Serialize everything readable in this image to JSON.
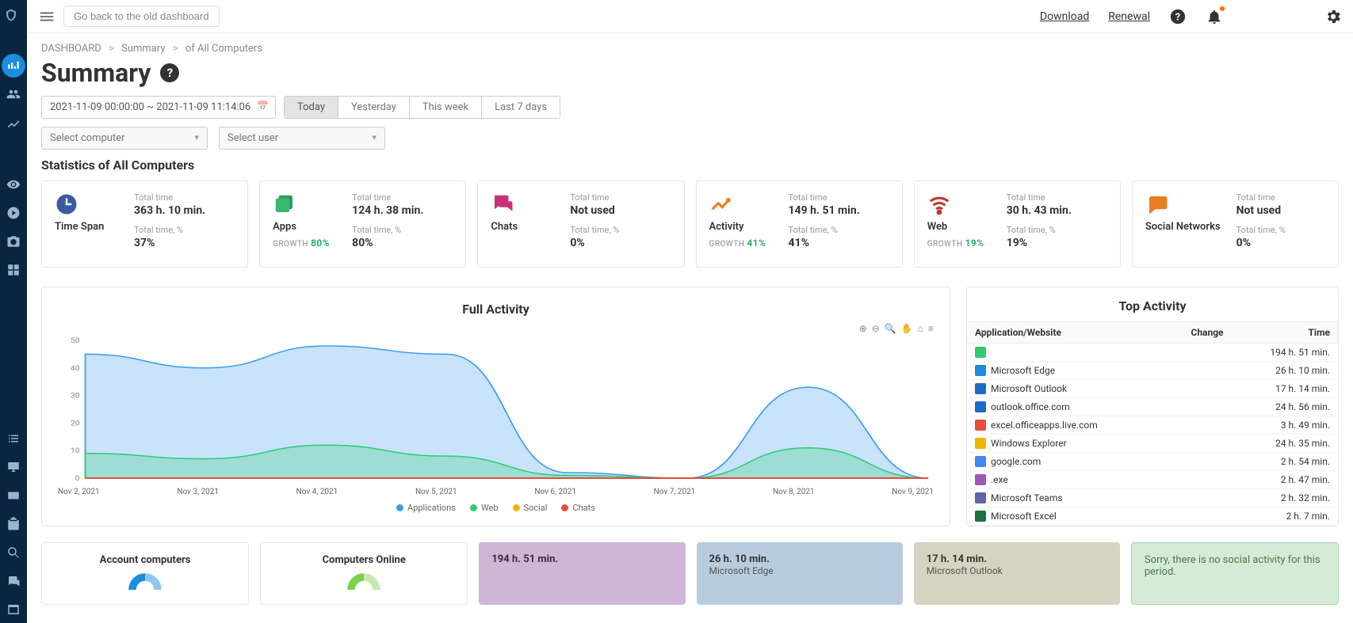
{
  "topbar": {
    "old_dashboard": "Go back to the old dashboard",
    "download": "Download",
    "renewal": "Renewal"
  },
  "breadcrumb": {
    "item1": "DASHBOARD",
    "item2": "Summary",
    "item3": "of All Computers"
  },
  "page_title": "Summary",
  "filters": {
    "date_range": "2021-11-09 00:00:00 ~ 2021-11-09 11:14:06",
    "today": "Today",
    "yesterday": "Yesterday",
    "this_week": "This week",
    "last_7": "Last 7 days",
    "select_computer": "Select computer",
    "select_user": "Select user"
  },
  "section_title": "Statistics of All Computers",
  "cards": {
    "timespan": {
      "name": "Time Span",
      "total_label": "Total time",
      "total": "363 h. 10 min.",
      "pct_label": "Total time, %",
      "pct": "37%"
    },
    "apps": {
      "name": "Apps",
      "growth_label": "GROWTH",
      "growth": "80%",
      "total_label": "Total time",
      "total": "124 h. 38 min.",
      "pct_label": "Total time, %",
      "pct": "80%"
    },
    "chats": {
      "name": "Chats",
      "total_label": "Total time",
      "total": "Not used",
      "pct_label": "Total time, %",
      "pct": "0%"
    },
    "activity": {
      "name": "Activity",
      "growth_label": "GROWTH",
      "growth": "41%",
      "total_label": "Total time",
      "total": "149 h. 51 min.",
      "pct_label": "Total time, %",
      "pct": "41%"
    },
    "web": {
      "name": "Web",
      "growth_label": "GROWTH",
      "growth": "19%",
      "total_label": "Total time",
      "total": "30 h. 43 min.",
      "pct_label": "Total time, %",
      "pct": "19%"
    },
    "social": {
      "name": "Social Networks",
      "total_label": "Total time",
      "total": "Not used",
      "pct_label": "Total time, %",
      "pct": "0%"
    }
  },
  "chart_data": {
    "type": "area",
    "title": "Full Activity",
    "x": [
      "Nov 2, 2021",
      "Nov 3, 2021",
      "Nov 4, 2021",
      "Nov 5, 2021",
      "Nov 6, 2021",
      "Nov 7, 2021",
      "Nov 8, 2021",
      "Nov 9, 2021"
    ],
    "ylim": [
      0,
      50
    ],
    "yticks": [
      0,
      10,
      20,
      30,
      40,
      50
    ],
    "series": [
      {
        "name": "Applications",
        "color": "#3a9cef",
        "values": [
          45,
          40,
          48,
          45,
          2,
          0,
          33,
          0
        ]
      },
      {
        "name": "Web",
        "color": "#2ecc71",
        "values": [
          9,
          7,
          12,
          8,
          1,
          0,
          11,
          0
        ]
      },
      {
        "name": "Social",
        "color": "#f5b301",
        "values": [
          0,
          0,
          0,
          0,
          0,
          0,
          0,
          0
        ]
      },
      {
        "name": "Chats",
        "color": "#e74c3c",
        "values": [
          0,
          0,
          0,
          0,
          0,
          0,
          0,
          0
        ]
      }
    ],
    "legend": [
      "Applications",
      "Web",
      "Social",
      "Chats"
    ]
  },
  "top_activity": {
    "title": "Top Activity",
    "col_app": "Application/Website",
    "col_change": "Change",
    "col_time": "Time",
    "rows": [
      {
        "name": "",
        "time": "194 h. 51 min.",
        "color": "#2ecc71"
      },
      {
        "name": "Microsoft Edge",
        "time": "26 h. 10 min.",
        "color": "#1c8cdc"
      },
      {
        "name": "Microsoft Outlook",
        "time": "17 h. 14 min.",
        "color": "#1c6cc9"
      },
      {
        "name": "outlook.office.com",
        "time": "24 h. 56 min.",
        "color": "#1c6cc9"
      },
      {
        "name": "excel.officeapps.live.com",
        "time": "3 h. 49 min.",
        "color": "#e74c3c"
      },
      {
        "name": "Windows Explorer",
        "time": "24 h. 35 min.",
        "color": "#f5b301"
      },
      {
        "name": "google.com",
        "time": "2 h. 54 min.",
        "color": "#4285f4"
      },
      {
        "name": ".exe",
        "time": "2 h. 47 min.",
        "color": "#9b59b6"
      },
      {
        "name": "Microsoft Teams",
        "time": "2 h. 32 min.",
        "color": "#6264a7"
      },
      {
        "name": "Microsoft Excel",
        "time": "2 h. 7 min.",
        "color": "#1d6f42"
      }
    ]
  },
  "bottom": {
    "account": "Account computers",
    "online": "Computers Online",
    "t1_big": "194 h. 51 min.",
    "t2_big": "26 h. 10 min.",
    "t2_sub": "Microsoft Edge",
    "t3_big": "17 h. 14 min.",
    "t3_sub": "Microsoft Outlook",
    "no_social": "Sorry, there is no social activity for this period."
  }
}
